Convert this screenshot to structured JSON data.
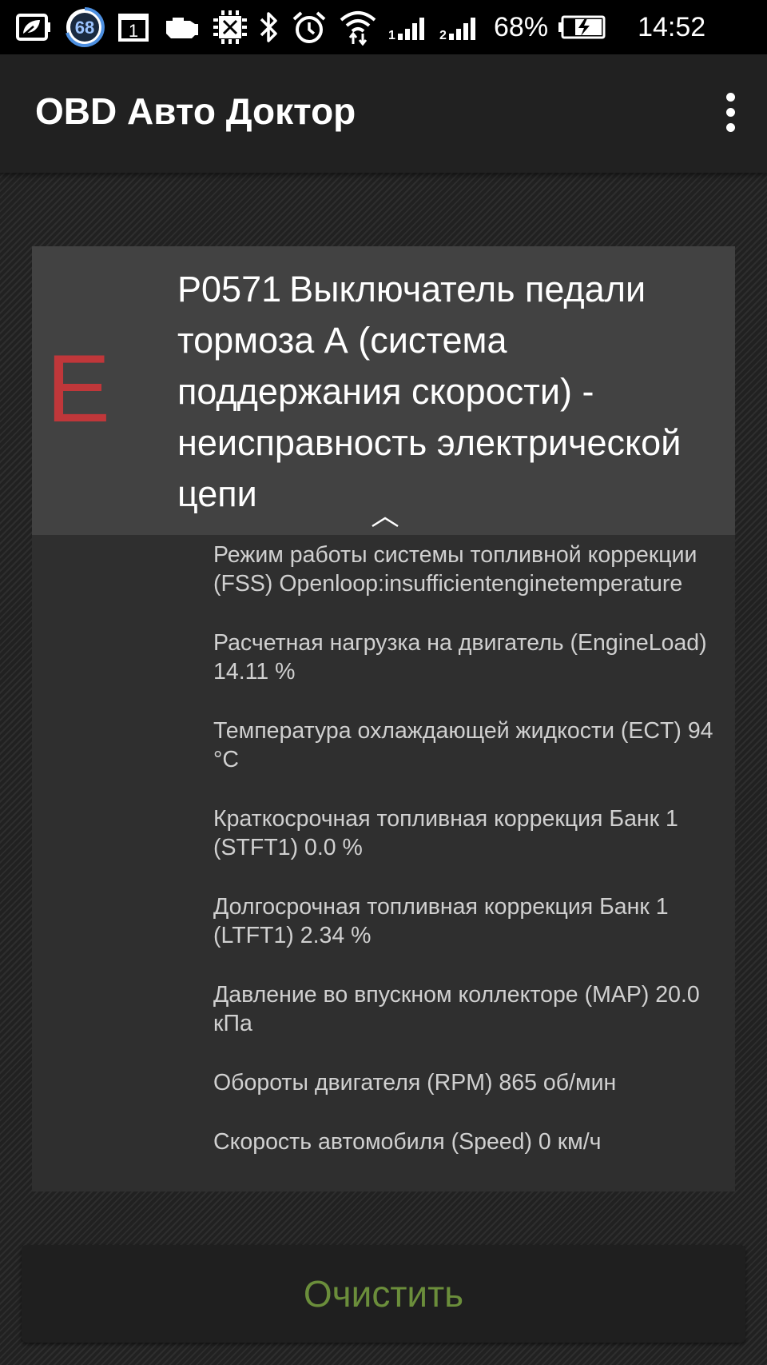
{
  "status_bar": {
    "icons": [
      "eco-battery-icon",
      "badge-68-icon",
      "calendar-1-icon",
      "car-engine-icon",
      "obd-chip-icon",
      "bluetooth-icon",
      "alarm-icon",
      "wifi-icon",
      "signal-sim1-icon",
      "signal-sim2-icon",
      "battery-charging-icon"
    ],
    "badge_count": "68",
    "calendar_day": "1",
    "battery": "68%",
    "time": "14:52"
  },
  "app_bar": {
    "title": "OBD Авто Доктор"
  },
  "fault": {
    "type_letter": "E",
    "type_color": "#c0373a",
    "code": "P0571",
    "description": "Выключатель педали тормоза А (система поддержания скорости) - неисправность электрической цепи"
  },
  "parameters": [
    {
      "label": "Режим работы системы топливной коррекции (FSS)",
      "value": "Openloop:insufficientenginetemperature"
    },
    {
      "label": "Расчетная нагрузка на двигатель (EngineLoad)",
      "value": "14.11 %"
    },
    {
      "label": "Температура охлаждающей жидкости (ECT)",
      "value": "94 °C"
    },
    {
      "label": "Краткосрочная топливная коррекция Банк 1 (STFT1)",
      "value": "0.0 %"
    },
    {
      "label": "Долгосрочная топливная коррекция Банк 1 (LTFT1)",
      "value": "2.34 %"
    },
    {
      "label": "Давление во впускном коллекторе (MAP)",
      "value": "20.0 кПа"
    },
    {
      "label": "Обороты двигателя (RPM)",
      "value": "865 об/мин"
    },
    {
      "label": "Скорость автомобиля (Speed)",
      "value": "0 км/ч"
    }
  ],
  "actions": {
    "clear_label": "Очистить",
    "clear_color": "#6b8e3b"
  }
}
